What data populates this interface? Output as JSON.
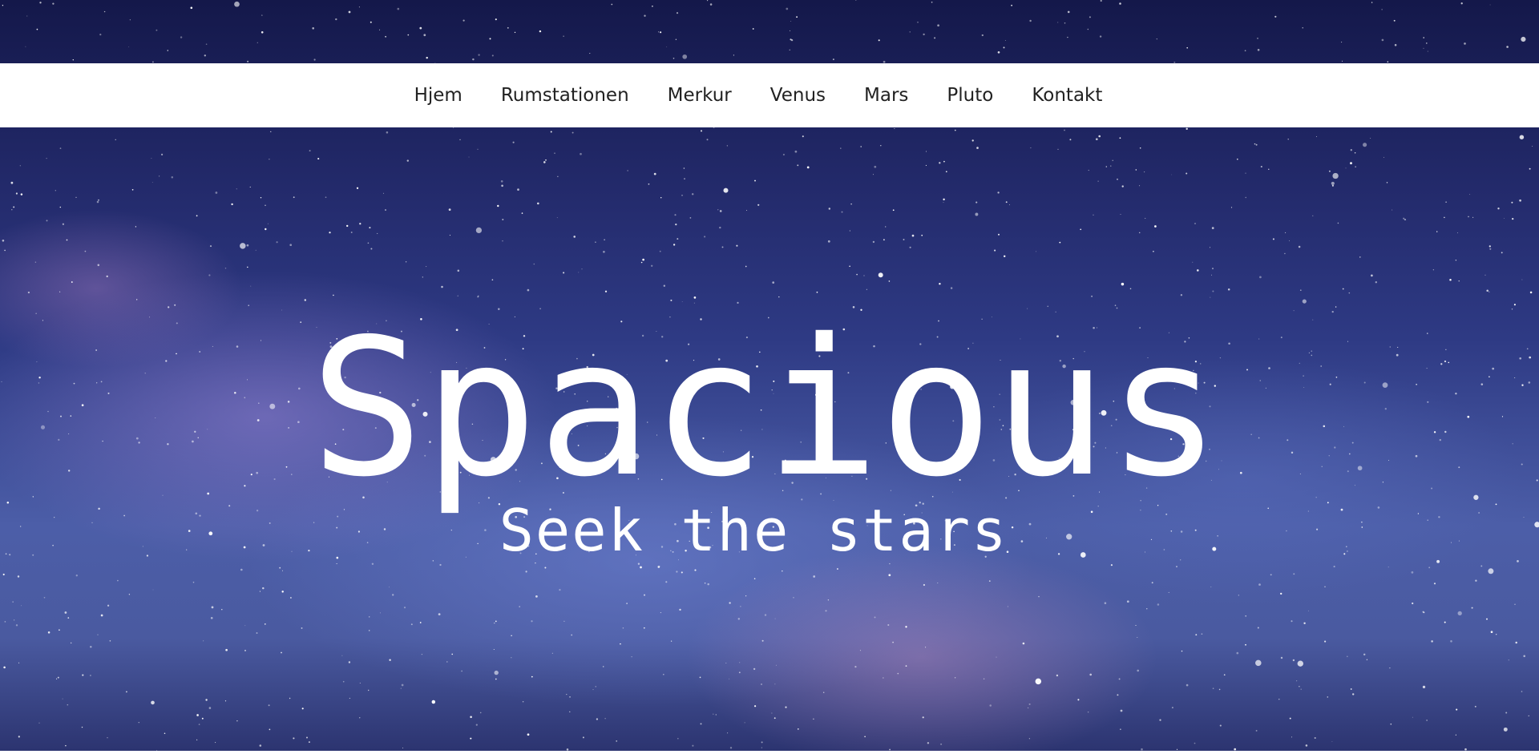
{
  "nav": {
    "items": [
      {
        "label": "Hjem"
      },
      {
        "label": "Rumstationen"
      },
      {
        "label": "Merkur"
      },
      {
        "label": "Venus"
      },
      {
        "label": "Mars"
      },
      {
        "label": "Pluto"
      },
      {
        "label": "Kontakt"
      }
    ]
  },
  "hero": {
    "title": "Spacious",
    "subtitle": "Seek the stars"
  },
  "colors": {
    "nav_background": "#ffffff",
    "nav_text": "#222222",
    "hero_text": "#ffffff",
    "sky_top": "#14184a",
    "sky_mid": "#4c5ea8"
  }
}
